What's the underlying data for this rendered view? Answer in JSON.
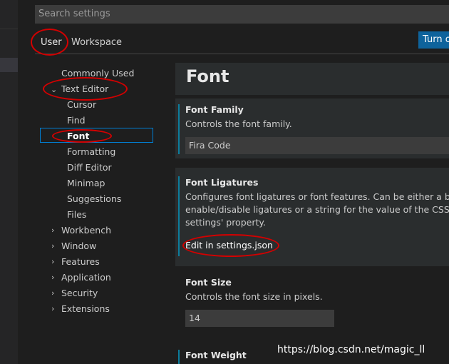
{
  "search": {
    "placeholder": "Search settings"
  },
  "tabs": {
    "user": "User",
    "workspace": "Workspace"
  },
  "turn_on_button": "Turn o",
  "toc": {
    "commonly_used": "Commonly Used",
    "text_editor": "Text Editor",
    "text_editor_children": [
      "Cursor",
      "Find",
      "Font",
      "Formatting",
      "Diff Editor",
      "Minimap",
      "Suggestions",
      "Files"
    ],
    "others": [
      "Workbench",
      "Window",
      "Features",
      "Application",
      "Security",
      "Extensions"
    ]
  },
  "content": {
    "section_title": "Font",
    "font_family": {
      "title": "Font Family",
      "desc": "Controls the font family.",
      "value": "Fira Code"
    },
    "font_ligatures": {
      "title": "Font Ligatures",
      "desc_lines": [
        "Configures font ligatures or font features. Can be either a bool",
        "enable/disable ligatures or a string for the value of the CSS 'for",
        "settings' property."
      ],
      "link": "Edit in settings.json"
    },
    "font_size": {
      "title": "Font Size",
      "desc": "Controls the font size in pixels.",
      "value": "14"
    },
    "font_weight": {
      "title": "Font Weight"
    }
  },
  "watermark": "https://blog.csdn.net/magic_ll",
  "colors": {
    "accent": "#0e639c",
    "focus_border": "#007fd4",
    "annotation": "#d40000",
    "modified_bar": "#0c7d9d"
  }
}
